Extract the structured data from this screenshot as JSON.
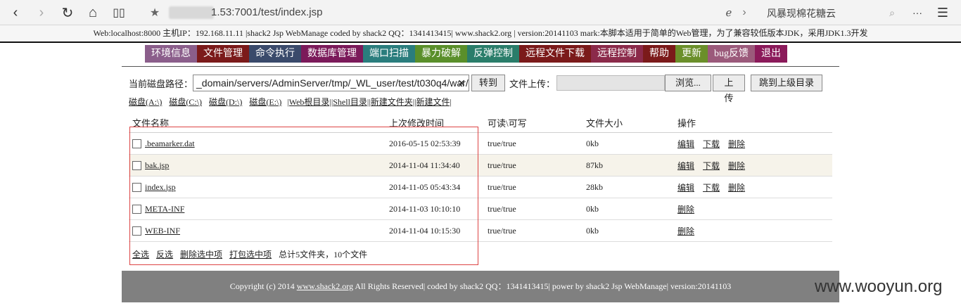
{
  "browser": {
    "url": "1.53:7001/test/index.jsp",
    "page_title": "风暴现棉花糖云",
    "back_icon": "‹",
    "forward_icon": "›",
    "more_icon": "···",
    "menu_icon": "☰"
  },
  "infobar": {
    "text": "Web:localhost:8000 主机IP：192.168.11.11 |shack2 Jsp WebManage coded by shack2 QQ：1341413415| www.shack2.org | version:20141103 mark:本脚本适用于简单的Web管理，为了兼容较低版本JDK，采用JDK1.3开发"
  },
  "menu": [
    {
      "label": "环境信息",
      "color": "#8b5e8b"
    },
    {
      "label": "文件管理",
      "color": "#7b1a1a"
    },
    {
      "label": "命令执行",
      "color": "#3a4a6b"
    },
    {
      "label": "数据库管理",
      "color": "#7b1a5a"
    },
    {
      "label": "端口扫描",
      "color": "#2a7d7d"
    },
    {
      "label": "暴力破解",
      "color": "#5a8f2a"
    },
    {
      "label": "反弹控制",
      "color": "#2a7d6a"
    },
    {
      "label": "远程文件下载",
      "color": "#7b1a1a"
    },
    {
      "label": "远程控制",
      "color": "#8b2a4a"
    },
    {
      "label": "帮助",
      "color": "#7b1a1a"
    },
    {
      "label": "更新",
      "color": "#6b8f2a"
    },
    {
      "label": "bug反馈",
      "color": "#9b5a7b"
    },
    {
      "label": "退出",
      "color": "#8b1a5a"
    }
  ],
  "toolbar": {
    "path_label": "当前磁盘路径：",
    "path_value": "_domain/servers/AdminServer/tmp/_WL_user/test/t030q4/war/",
    "goto_label": "转到",
    "upload_label": "文件上传：",
    "browse_label": "浏览...",
    "upload_button": "上传",
    "parent_button": "跳到上级目录"
  },
  "drives": [
    "磁盘(A:\\)",
    "磁盘(C:\\)",
    "磁盘(D:\\)",
    "磁盘(E:\\)",
    "|Web根目录|",
    "|Shell目录|",
    "|新建文件夹|",
    "|新建文件|"
  ],
  "table": {
    "headers": [
      "文件名称",
      "上次修改时间",
      "可读\\可写",
      "文件大小",
      "操作"
    ],
    "rows": [
      {
        "name": ".beamarker.dat",
        "time": "2016-05-15 02:53:39",
        "rw": "true/true",
        "size": "0kb",
        "ops": [
          "编辑",
          "下载",
          "删除"
        ]
      },
      {
        "name": "bak.jsp",
        "time": "2014-11-04 11:34:40",
        "rw": "true/true",
        "size": "87kb",
        "ops": [
          "编辑",
          "下载",
          "删除"
        ]
      },
      {
        "name": "index.jsp",
        "time": "2014-11-05 05:43:34",
        "rw": "true/true",
        "size": "28kb",
        "ops": [
          "编辑",
          "下载",
          "删除"
        ]
      },
      {
        "name": "META-INF",
        "time": "2014-11-03 10:10:10",
        "rw": "true/true",
        "size": "0kb",
        "ops": [
          "删除"
        ]
      },
      {
        "name": "WEB-INF",
        "time": "2014-11-04 10:15:30",
        "rw": "true/true",
        "size": "0kb",
        "ops": [
          "删除"
        ]
      }
    ],
    "footer_links": [
      "全选",
      "反选",
      "删除选中项",
      "打包选中项"
    ],
    "summary": "总计5文件夹，10个文件"
  },
  "footer": {
    "prefix": "Copyright (c) 2014 ",
    "link": "www.shack2.org",
    "suffix": " All Rights Reserved| coded by shack2 QQ：1341413415| power by shack2 Jsp WebManage| version:20141103"
  },
  "watermark": "www.wooyun.org"
}
